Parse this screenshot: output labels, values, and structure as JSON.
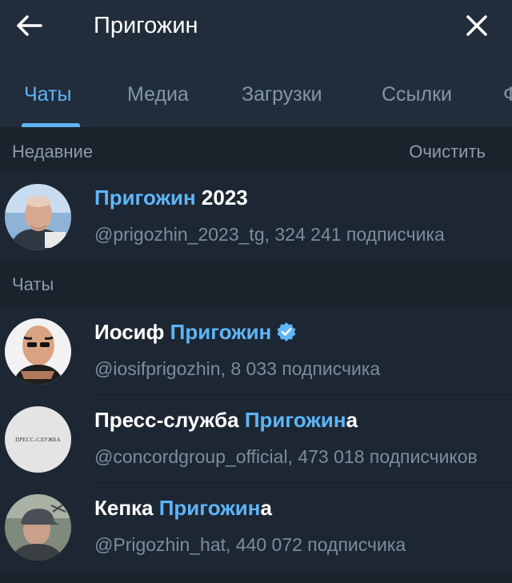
{
  "header": {
    "search_value": "Пригожин",
    "back_icon": "arrow-left-icon",
    "close_icon": "close-icon"
  },
  "tabs": [
    {
      "label": "Чаты",
      "active": true
    },
    {
      "label": "Медиа",
      "active": false
    },
    {
      "label": "Загрузки",
      "active": false
    },
    {
      "label": "Ссылки",
      "active": false
    },
    {
      "label": "Ф",
      "active": false
    }
  ],
  "recent": {
    "title": "Недавние",
    "clear_label": "Очистить",
    "items": [
      {
        "name_highlight": "Пригожин",
        "name_rest": " 2023",
        "subtitle": "@prigozhin_2023_tg, 324 241 подписчика"
      }
    ]
  },
  "chats": {
    "title": "Чаты",
    "items": [
      {
        "name_before": "Иосиф ",
        "name_highlight": "Пригожин",
        "name_after": "",
        "verified": true,
        "subtitle": "@iosifprigozhin, 8 033 подписчика"
      },
      {
        "name_before": "Пресс-служба ",
        "name_highlight": "Пригожин",
        "name_after": "а",
        "verified": false,
        "avatar_text": "ПРЕСС-СЛУЖБА",
        "subtitle": "@concordgroup_official, 473 018 подписчиков"
      },
      {
        "name_before": "Кепка ",
        "name_highlight": "Пригожин",
        "name_after": "а",
        "verified": false,
        "subtitle": "@Prigozhin_hat, 440 072 подписчика"
      }
    ]
  },
  "colors": {
    "background": "#1d2733",
    "header_bg": "#212d3b",
    "accent": "#5eb5f7",
    "secondary_text": "#7c8c9c"
  }
}
